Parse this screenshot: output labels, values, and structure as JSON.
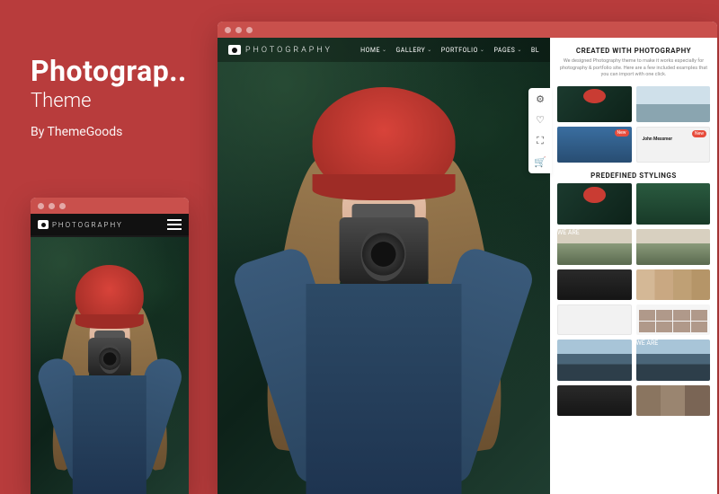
{
  "promo": {
    "title": "Photograp..",
    "subtitle": "Theme",
    "byline": "By ThemeGoods"
  },
  "logo_text": "PHOTOGRAPHY",
  "nav": {
    "home": "HOME",
    "gallery": "GALLERY",
    "portfolio": "PORTFOLIO",
    "pages": "PAGES",
    "blog": "BL"
  },
  "side_tools": {
    "settings": "gear-icon",
    "wishlist": "heart-icon",
    "fullscreen": "expand-icon",
    "cart": "cart-icon"
  },
  "panel": {
    "section1_title": "CREATED WITH PHOTOGRAPHY",
    "section1_desc": "We designed Photography theme to make it works especially for photography & portfolio site. Here are a few included examples that you can import with one click.",
    "section2_title": "PREDEFINED STYLINGS",
    "badge_new": "New",
    "john_name": "John\nMessmer",
    "weare": "WE ARE"
  }
}
